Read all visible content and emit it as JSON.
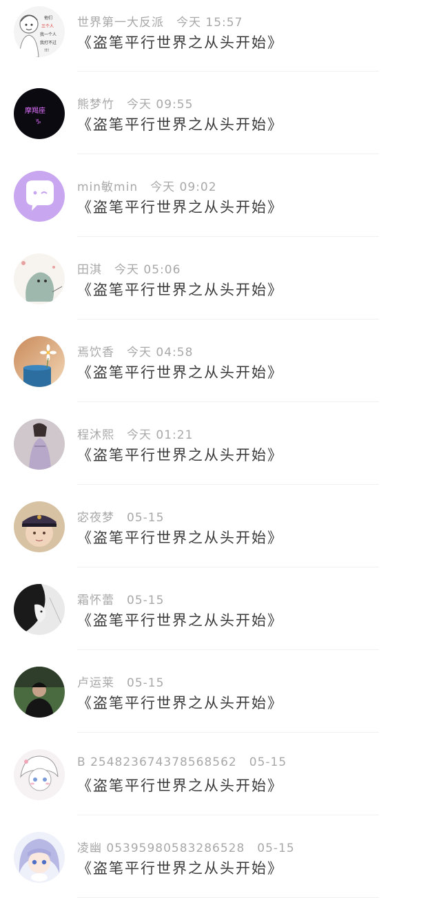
{
  "comments": [
    {
      "user": "世界第一大反派",
      "time": "今天 15:57",
      "text": "《盗笔平行世界之从头开始》",
      "avatar": "cartoon-sketch-avatar",
      "avatar_text": [
        "他们",
        "三个人",
        "我一个人",
        "我打不过",
        "!!!"
      ]
    },
    {
      "user": "熊梦竹",
      "time": "今天 09:55",
      "text": "《盗笔平行世界之从头开始》",
      "avatar": "neon-sign-avatar",
      "avatar_text": [
        "摩羯座",
        "♑"
      ]
    },
    {
      "user": "min敏min",
      "time": "今天 09:02",
      "text": "《盗笔平行世界之从头开始》",
      "avatar": "purple-chat-bubble-avatar"
    },
    {
      "user": "田淇",
      "time": "今天 05:06",
      "text": "《盗笔平行世界之从头开始》",
      "avatar": "illustration-avatar"
    },
    {
      "user": "焉饮香",
      "time": "今天 04:58",
      "text": "《盗笔平行世界之从头开始》",
      "avatar": "flower-cup-avatar"
    },
    {
      "user": "程沐熙",
      "time": "今天 01:21",
      "text": "《盗笔平行世界之从头开始》",
      "avatar": "hanfu-photo-avatar"
    },
    {
      "user": "宓夜梦",
      "time": "05-15",
      "text": "《盗笔平行世界之从头开始》",
      "avatar": "child-captain-hat-avatar"
    },
    {
      "user": "霜怀蕾",
      "time": "05-15",
      "text": "《盗笔平行世界之从头开始》",
      "avatar": "monochrome-portrait-avatar"
    },
    {
      "user": "卢运莱",
      "time": "05-15",
      "text": "《盗笔平行世界之从头开始》",
      "avatar": "man-in-cap-avatar"
    },
    {
      "user": "B 254823674378568562",
      "time": "05-15",
      "text": "《盗笔平行世界之从头开始》",
      "avatar": "anime-sketch-avatar"
    },
    {
      "user": "凌幽 05395980583286528",
      "time": "05-15",
      "text": "《盗笔平行世界之从头开始》",
      "avatar": "anime-girl-avatar"
    }
  ]
}
